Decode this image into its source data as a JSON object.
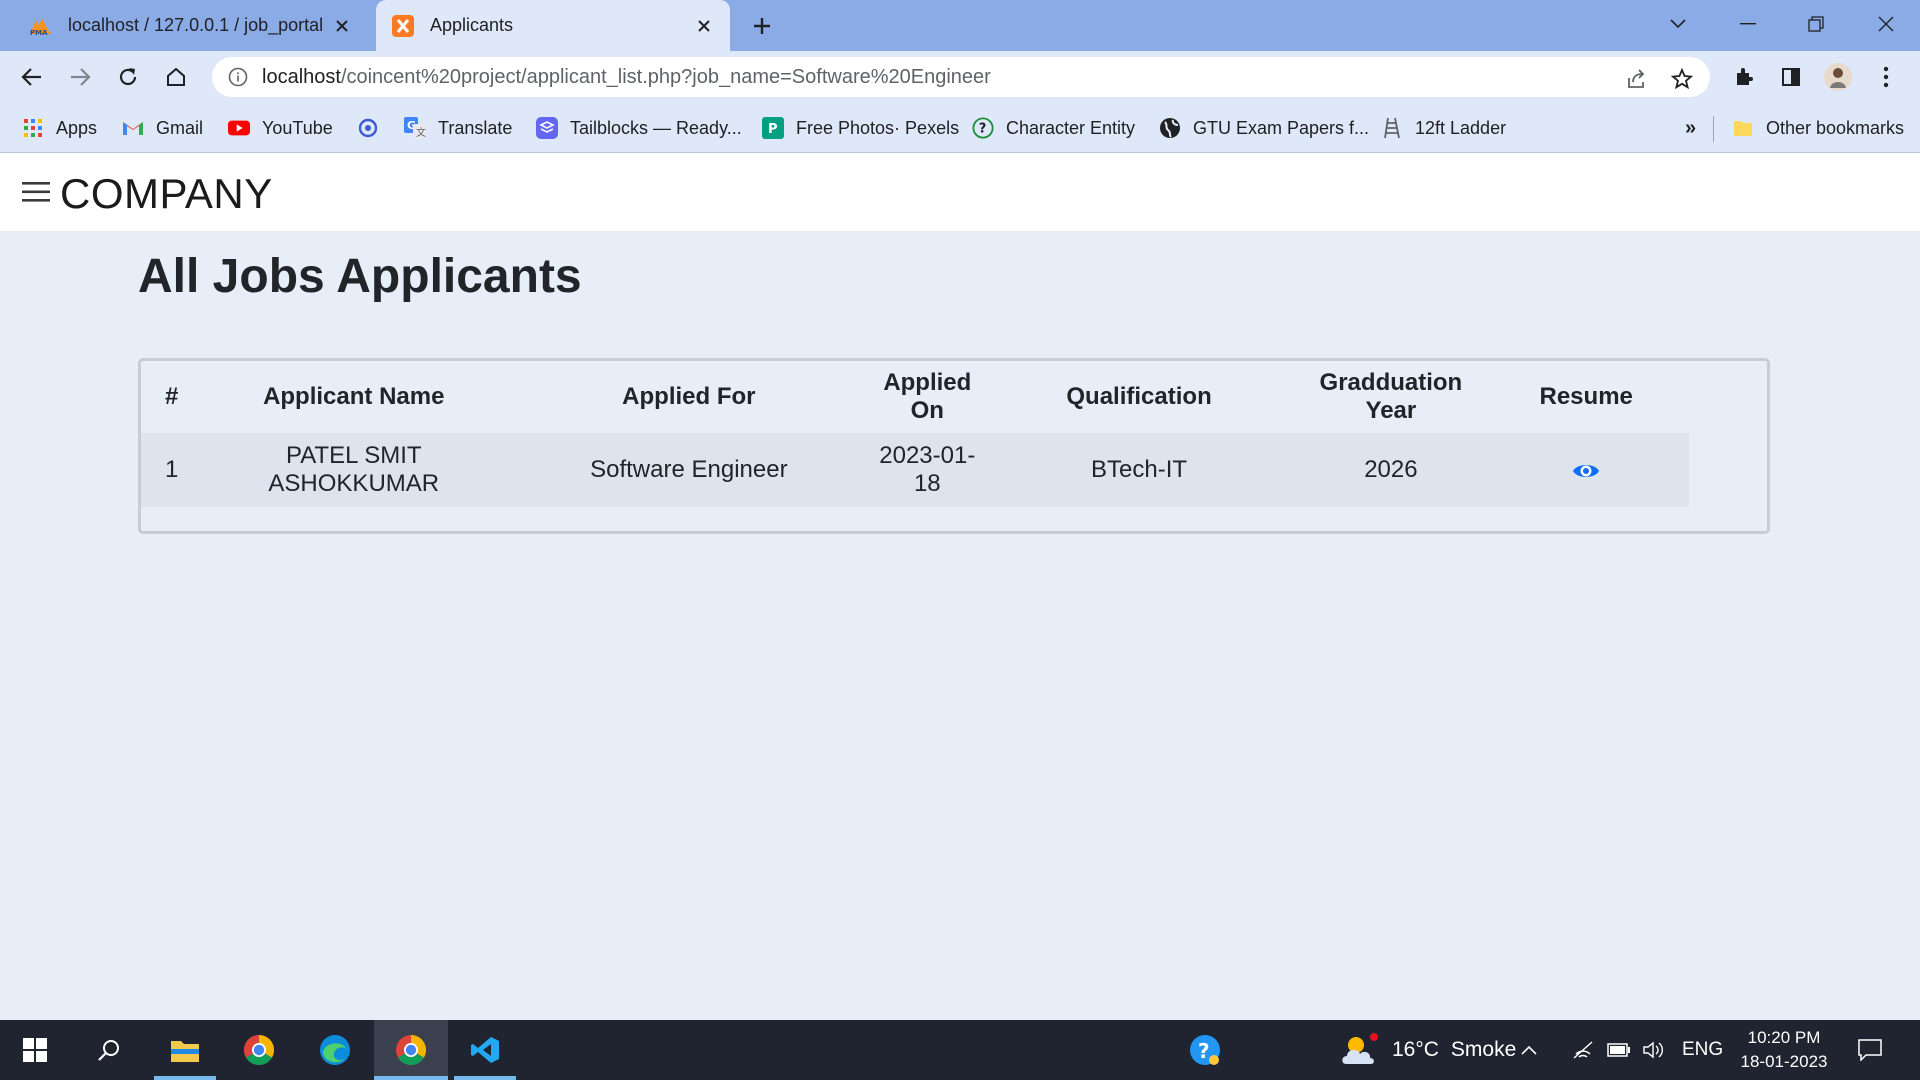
{
  "browser": {
    "tabs": [
      {
        "label": "localhost / 127.0.0.1 / job_portal",
        "favicon": "phpmyadmin-icon",
        "active": false
      },
      {
        "label": "Applicants",
        "favicon": "xampp-icon",
        "active": true
      }
    ],
    "url": {
      "host": "localhost",
      "path": "/coincent%20project/applicant_list.php?job_name=Software%20Engineer"
    },
    "bookmarks": [
      {
        "label": "Apps",
        "icon": "apps-grid-icon"
      },
      {
        "label": "Gmail",
        "icon": "gmail-icon"
      },
      {
        "label": "YouTube",
        "icon": "youtube-icon"
      },
      {
        "label": "",
        "icon": "sync-icon"
      },
      {
        "label": "Translate",
        "icon": "translate-icon"
      },
      {
        "label": "Tailblocks — Ready...",
        "icon": "tailblocks-icon"
      },
      {
        "label": "Free Photos· Pexels",
        "icon": "pexels-icon"
      },
      {
        "label": "Character Entity",
        "icon": "question-circle-icon"
      },
      {
        "label": "GTU Exam Papers f...",
        "icon": "globe-icon"
      },
      {
        "label": "12ft Ladder",
        "icon": "ladder-icon"
      }
    ],
    "bookmarks_overflow": "»",
    "other_bookmarks": "Other bookmarks"
  },
  "page": {
    "brand": "COMPANY",
    "title": "All Jobs Applicants",
    "table": {
      "headers": [
        "#",
        "Applicant Name",
        "Applied For",
        "Applied On",
        "Qualification",
        "Gradduation Year",
        "Resume"
      ],
      "rows": [
        {
          "num": "1",
          "name": "PATEL SMIT ASHOKKUMAR",
          "applied_for": "Software Engineer",
          "applied_on": "2023-01-18",
          "qualification": "BTech-IT",
          "graduation_year": "2026",
          "resume_icon": "eye-icon"
        }
      ]
    },
    "accent_color": "#0d6efd"
  },
  "taskbar": {
    "weather": {
      "temp": "16°C",
      "condition": "Smoke"
    },
    "language": "ENG",
    "time": "10:20 PM",
    "date": "18-01-2023"
  }
}
